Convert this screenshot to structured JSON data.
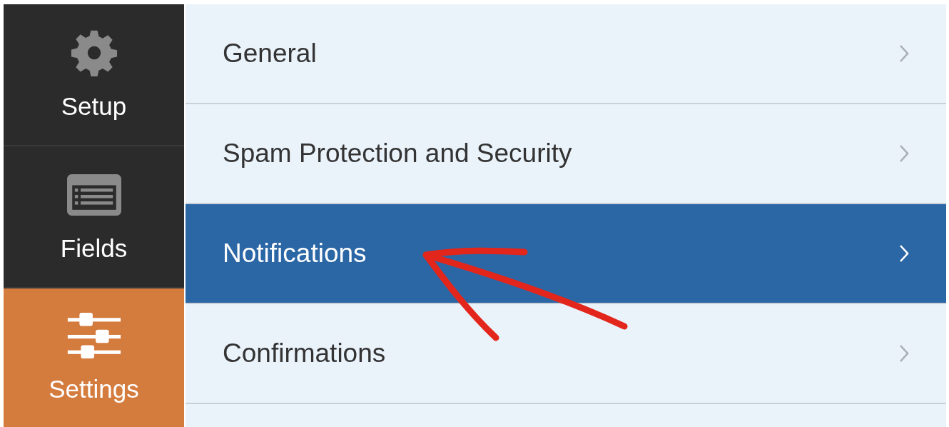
{
  "sidebar": {
    "items": [
      {
        "label": "Setup",
        "kind": "gear",
        "selected": false
      },
      {
        "label": "Fields",
        "kind": "fields",
        "selected": false
      },
      {
        "label": "Settings",
        "kind": "sliders",
        "selected": true
      }
    ]
  },
  "settings_menu": {
    "items": [
      {
        "label": "General",
        "selected": false
      },
      {
        "label": "Spam Protection and Security",
        "selected": false
      },
      {
        "label": "Notifications",
        "selected": true
      },
      {
        "label": "Confirmations",
        "selected": false
      }
    ]
  },
  "annotation": {
    "kind": "arrow"
  }
}
